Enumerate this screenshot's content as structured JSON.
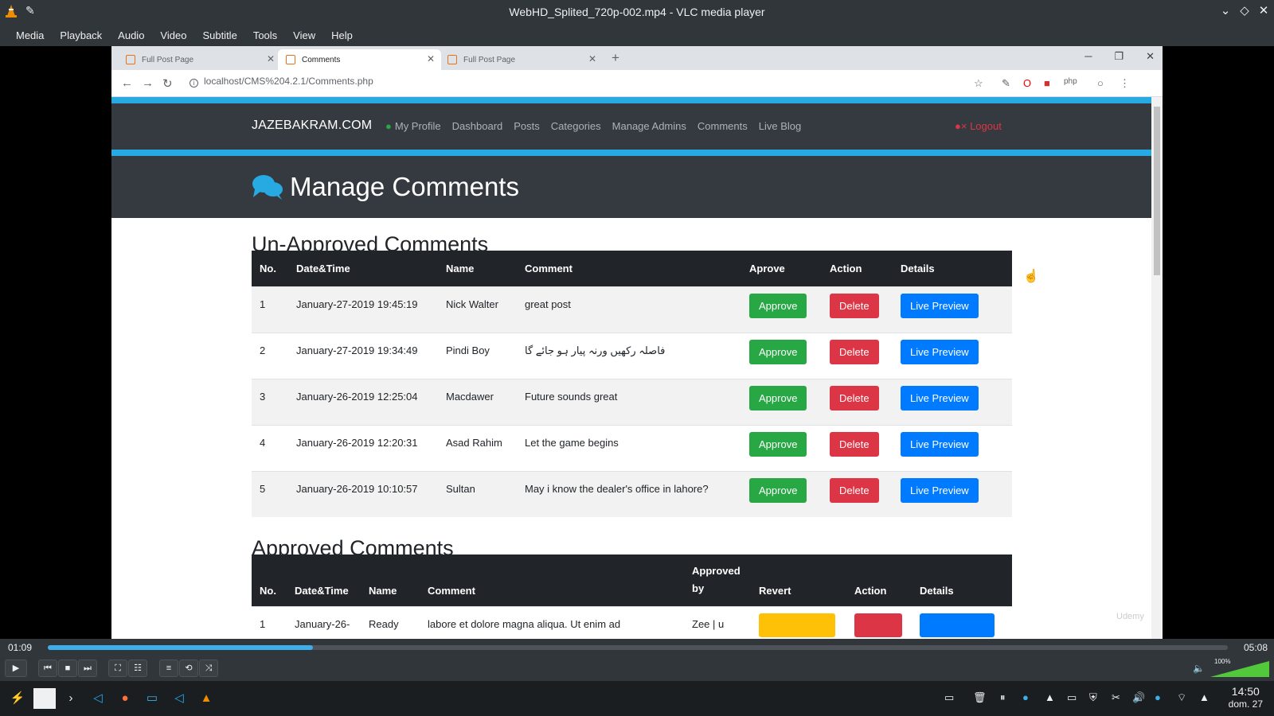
{
  "vlc": {
    "window_title": "WebHD_Splited_720p-002.mp4 - VLC media player",
    "menu": [
      "Media",
      "Playback",
      "Audio",
      "Video",
      "Subtitle",
      "Tools",
      "View",
      "Help"
    ],
    "time_current": "01:09",
    "time_total": "05:08",
    "progress_fraction": 0.225,
    "volume_label": "100%",
    "volume_fraction": 1.0
  },
  "browser": {
    "tabs": [
      {
        "title": "Full Post Page",
        "active": false
      },
      {
        "title": "Comments",
        "active": true
      },
      {
        "title": "Full Post Page",
        "active": false
      }
    ],
    "url": "localhost/CMS%204.2.1/Comments.php"
  },
  "site": {
    "brand": "JAZEBAKRAM.COM",
    "nav": [
      "My Profile",
      "Dashboard",
      "Posts",
      "Categories",
      "Manage Admins",
      "Comments",
      "Live Blog"
    ],
    "logout": "Logout",
    "page_title": "Manage Comments",
    "unapproved_heading": "Un-Approved Comments",
    "approved_heading": "Approved Comments",
    "unapproved_headers": [
      "No.",
      "Date&Time",
      "Name",
      "Comment",
      "Aprove",
      "Action",
      "Details"
    ],
    "unapproved_rows": [
      {
        "no": "1",
        "datetime": "January-27-2019 19:45:19",
        "name": "Nick Walter",
        "comment": "great post"
      },
      {
        "no": "2",
        "datetime": "January-27-2019 19:34:49",
        "name": "Pindi Boy",
        "comment": "فاصلہ رکھیں ورنہ پیار ہو جائے گا"
      },
      {
        "no": "3",
        "datetime": "January-26-2019 12:25:04",
        "name": "Macdawer",
        "comment": "Future sounds great"
      },
      {
        "no": "4",
        "datetime": "January-26-2019 12:20:31",
        "name": "Asad Rahim",
        "comment": "Let the game begins"
      },
      {
        "no": "5",
        "datetime": "January-26-2019 10:10:57",
        "name": "Sultan",
        "comment": "May i know the dealer's office in lahore?"
      }
    ],
    "btn_approve": "Approve",
    "btn_delete": "Delete",
    "btn_preview": "Live Preview",
    "approved_headers": [
      "No.",
      "Date&Time",
      "Name",
      "Comment",
      "Approved by",
      "Revert",
      "Action",
      "Details"
    ],
    "approved_rows": [
      {
        "no": "1",
        "datetime": "January-26-",
        "name": "Ready",
        "comment": "labore et dolore magna aliqua. Ut enim ad",
        "approved_by": "Zee | u"
      }
    ],
    "watermark": "Udemy"
  },
  "taskbar": {
    "time": "14:50",
    "date": "dom. 27"
  }
}
